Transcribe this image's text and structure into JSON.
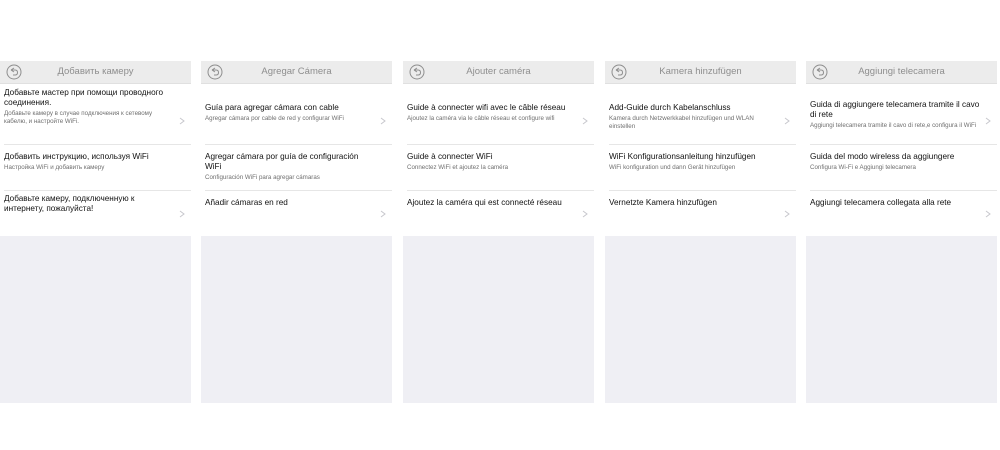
{
  "panels": [
    {
      "title": "Добавить камеру",
      "items": [
        {
          "title": " Добавьте мастер при помощи проводного соединения.",
          "sub": " Добавьте камеру в случае подключения к сетевому кабелю, и настройте WiFi."
        },
        {
          "title": "Добавить инструкцию, используя WiFi",
          "sub": "Настройка WiFi и добавить камеру"
        },
        {
          "title": " Добавьте камеру, подключенную к интернету, пожалуйста!",
          "sub": ""
        }
      ]
    },
    {
      "title": "Agregar Cámera",
      "items": [
        {
          "title": "Guía para agregar cámara con cable",
          "sub": "Agregar cámara por cable de red y configurar WiFi"
        },
        {
          "title": "Agregar cámara por guía de configuración WiFi",
          "sub": "Configuración WiFi para agregar cámaras"
        },
        {
          "title": "Añadir cámaras en red",
          "sub": ""
        }
      ]
    },
    {
      "title": "Ajouter caméra",
      "items": [
        {
          "title": "Guide à connecter wifi avec le câble réseau",
          "sub": "Ajoutez la caméra via le câble réseau et configure wifi"
        },
        {
          "title": "Guide à connecter WiFi",
          "sub": "Connectez WiFi et ajoutez la caméra"
        },
        {
          "title": "Ajoutez la caméra qui est connecté réseau",
          "sub": ""
        }
      ]
    },
    {
      "title": "Kamera hinzufügen",
      "items": [
        {
          "title": "Add-Guide durch Kabelanschluss",
          "sub": "Kamera durch Netzwerkkabel hinzufügen und WLAN einstellen"
        },
        {
          "title": "WiFi Konfigurationsanleitung hinzufügen",
          "sub": "WiFi konfiguration und dann Gerät hinzufügen"
        },
        {
          "title": "Vernetzte Kamera hinzufügen",
          "sub": ""
        }
      ]
    },
    {
      "title": "Aggiungi telecamera",
      "items": [
        {
          "title": "Guida di aggiungere telecamera tramite il cavo di rete",
          "sub": "Aggiungi telecamera tramite il cavo di rete,e configura il WiFi"
        },
        {
          "title": "Guida del modo wireless da aggiungere",
          "sub": "Configura Wi-Fi e Aggiungi telecamera"
        },
        {
          "title": "Aggiungi telecamera collegata alla rete",
          "sub": ""
        }
      ]
    }
  ]
}
